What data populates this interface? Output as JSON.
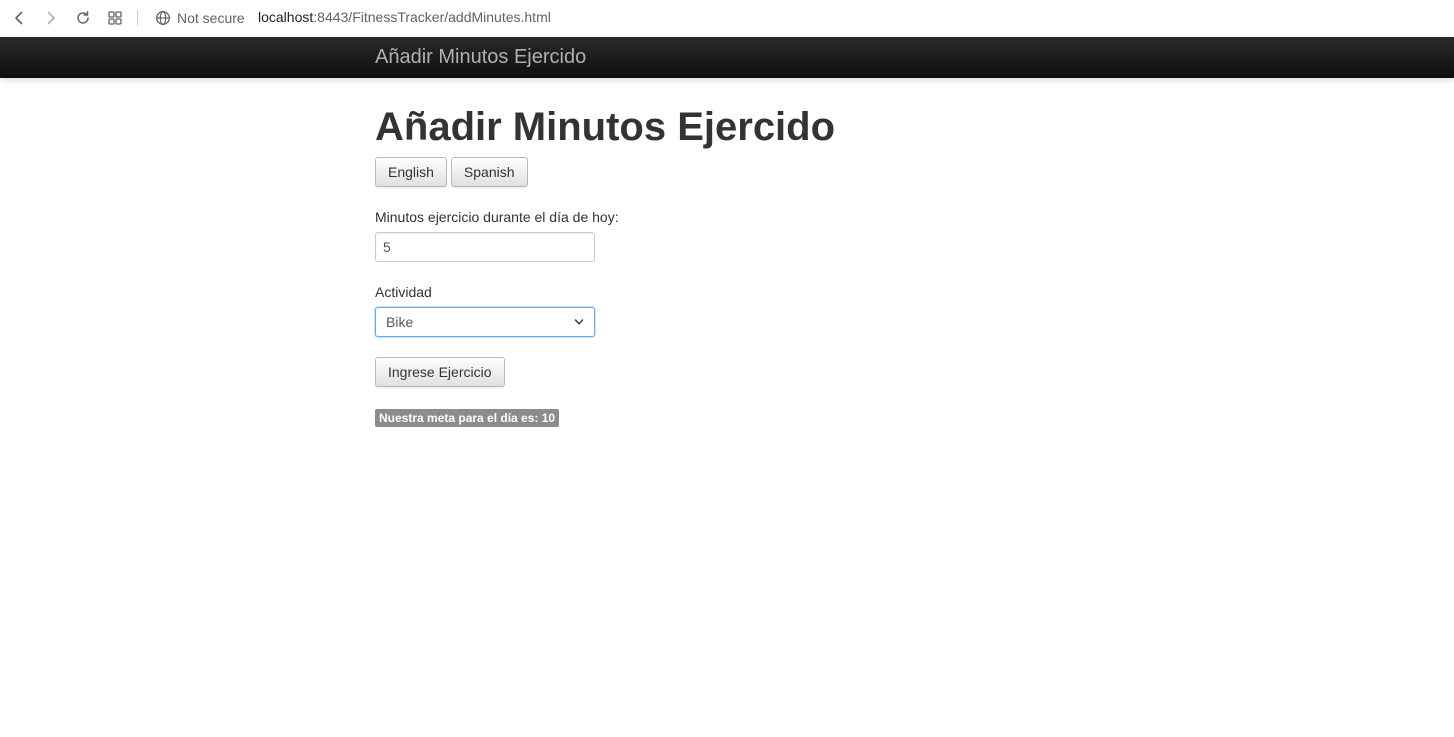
{
  "browser": {
    "security_label": "Not secure",
    "url_host": "localhost",
    "url_rest": ":8443/FitnessTracker/addMinutes.html"
  },
  "navbar": {
    "brand": "Añadir Minutos Ejercido"
  },
  "main": {
    "title": "Añadir Minutos Ejercido",
    "lang_buttons": [
      "English",
      "Spanish"
    ],
    "minutes_label": "Minutos ejercicio durante el día de hoy:",
    "minutes_value": "5",
    "activity_label": "Actividad",
    "activity_selected": "Bike",
    "submit_label": "Ingrese Ejercicio",
    "goal_badge": "Nuestra meta para el día es: 10"
  }
}
